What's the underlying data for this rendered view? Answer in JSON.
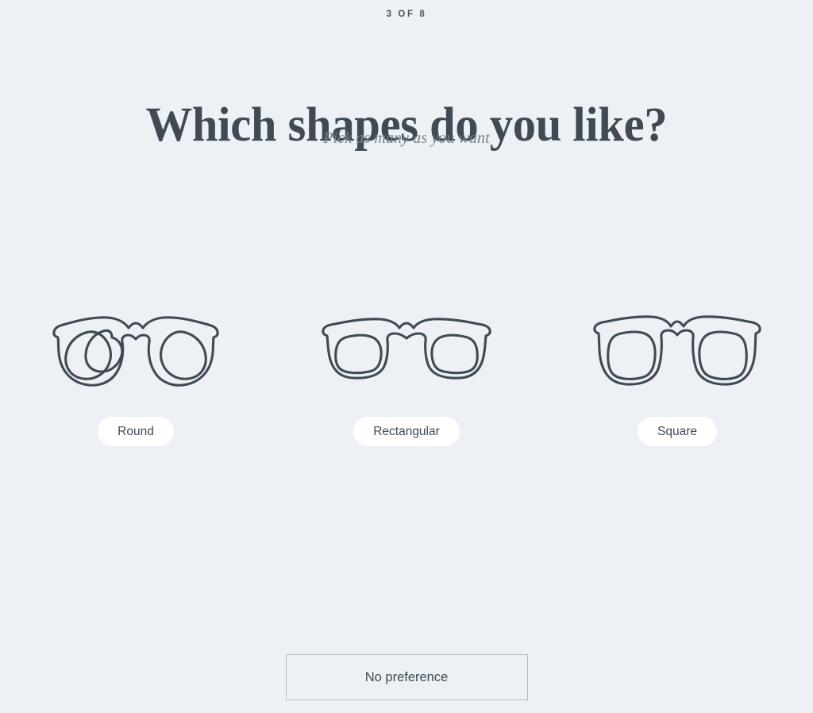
{
  "step": {
    "label": "3 OF 8"
  },
  "header": {
    "title": "Which shapes do you like?",
    "subtitle": "Pick as many as you want"
  },
  "options": [
    {
      "label": "Round",
      "icon": "round-glasses-icon"
    },
    {
      "label": "Rectangular",
      "icon": "rectangular-glasses-icon"
    },
    {
      "label": "Square",
      "icon": "square-glasses-icon"
    }
  ],
  "footer": {
    "no_preference_label": "No preference"
  },
  "colors": {
    "background": "#edf1f5",
    "ink": "#3f4a55",
    "muted": "#78828d",
    "pill_background": "#ffffff",
    "button_border": "#b4bac1"
  }
}
